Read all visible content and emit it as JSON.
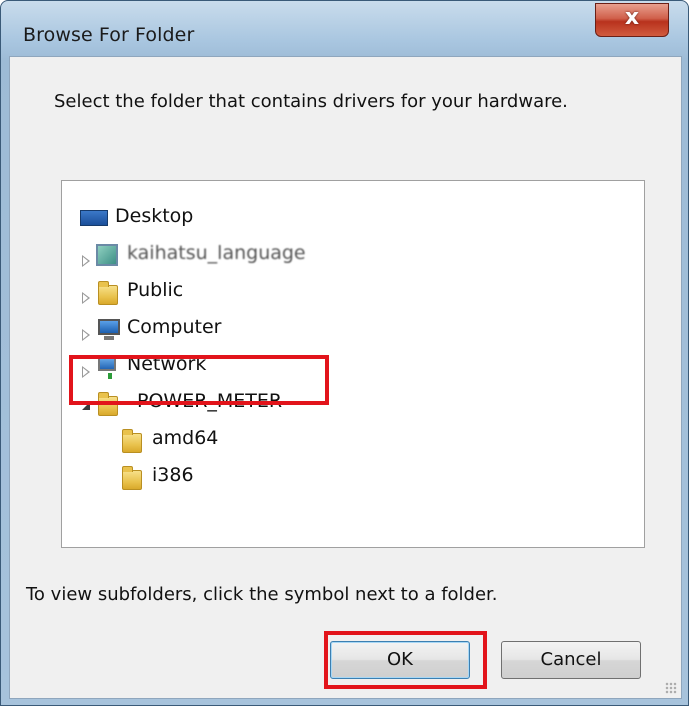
{
  "window": {
    "title": "Browse For Folder",
    "close_label": "x"
  },
  "dialog": {
    "prompt": "Select the folder that contains drivers for your hardware.",
    "hint": "To view subfolders, click the symbol next to a folder."
  },
  "tree": {
    "items": [
      {
        "label": "Desktop",
        "icon": "desktop-icon",
        "level": 0,
        "expander": "none"
      },
      {
        "label": "kaihatsu_language",
        "icon": "user-folder-icon",
        "level": 1,
        "expander": "collapsed",
        "blurred": true
      },
      {
        "label": "Public",
        "icon": "folder-icon",
        "level": 1,
        "expander": "collapsed"
      },
      {
        "label": "Computer",
        "icon": "computer-icon",
        "level": 1,
        "expander": "collapsed"
      },
      {
        "label": "Network",
        "icon": "network-icon",
        "level": 1,
        "expander": "collapsed"
      },
      {
        "label": "POWER_METER",
        "icon": "folder-icon",
        "level": 1,
        "expander": "expanded",
        "selected": true
      },
      {
        "label": "amd64",
        "icon": "folder-icon",
        "level": 2,
        "expander": "none"
      },
      {
        "label": "i386",
        "icon": "folder-icon",
        "level": 2,
        "expander": "none"
      }
    ]
  },
  "buttons": {
    "ok": "OK",
    "cancel": "Cancel"
  },
  "colors": {
    "highlight_box": "#e2141b",
    "titlebar": "#a9c6e0",
    "close_button": "#c8452c"
  }
}
